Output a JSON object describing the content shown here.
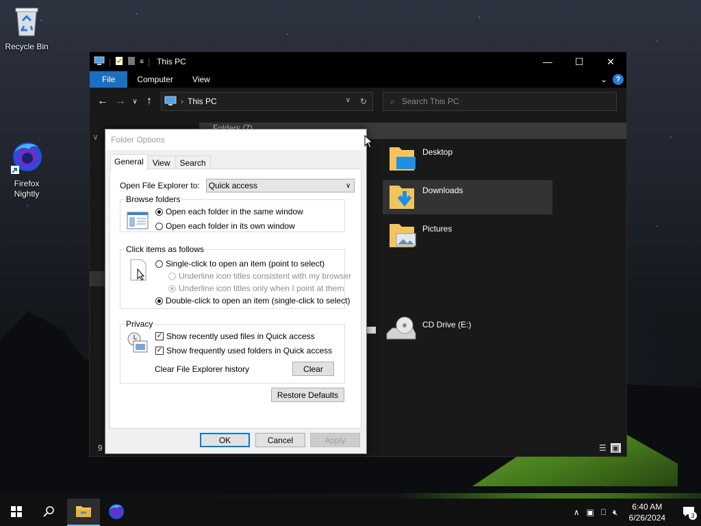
{
  "desktop": {
    "icons": [
      {
        "label": "Recycle Bin",
        "icon": "recycle-bin-icon"
      },
      {
        "label": "Firefox Nightly",
        "icon": "firefox-nightly-icon"
      }
    ]
  },
  "explorer": {
    "title": "This PC",
    "ribbon_tabs": [
      "File",
      "Computer",
      "View"
    ],
    "address": "This PC",
    "search_placeholder": "Search This PC",
    "group_header": "Folders (7)",
    "items": [
      {
        "label": "Desktop",
        "icon": "desktop-folder-icon"
      },
      {
        "label": "Downloads",
        "icon": "downloads-folder-icon",
        "selected": true
      },
      {
        "label": "Pictures",
        "icon": "pictures-folder-icon"
      },
      {
        "label": "CD Drive (E:)",
        "icon": "cd-drive-icon"
      }
    ],
    "status_count": "9"
  },
  "dialog": {
    "title": "Folder Options",
    "tabs": [
      "General",
      "View",
      "Search"
    ],
    "open_label": "Open File Explorer to:",
    "open_value": "Quick access",
    "browse": {
      "legend": "Browse folders",
      "opt_same": "Open each folder in the same window",
      "opt_own": "Open each folder in its own window"
    },
    "click": {
      "legend": "Click items as follows",
      "single": "Single-click to open an item (point to select)",
      "underline_browser": "Underline icon titles consistent with my browser",
      "underline_point": "Underline icon titles only when I point at them",
      "double": "Double-click to open an item (single-click to select)"
    },
    "privacy": {
      "legend": "Privacy",
      "recent_files": "Show recently used files in Quick access",
      "frequent_folders": "Show frequently used folders in Quick access",
      "clear_label": "Clear File Explorer history",
      "clear_button": "Clear"
    },
    "restore_defaults": "Restore Defaults",
    "ok": "OK",
    "cancel": "Cancel",
    "apply": "Apply"
  },
  "taskbar": {
    "time": "6:40 AM",
    "date": "6/26/2024",
    "notification_count": "3"
  },
  "colors": {
    "accent": "#1a6fc1",
    "default_button_border": "#0078d7"
  }
}
